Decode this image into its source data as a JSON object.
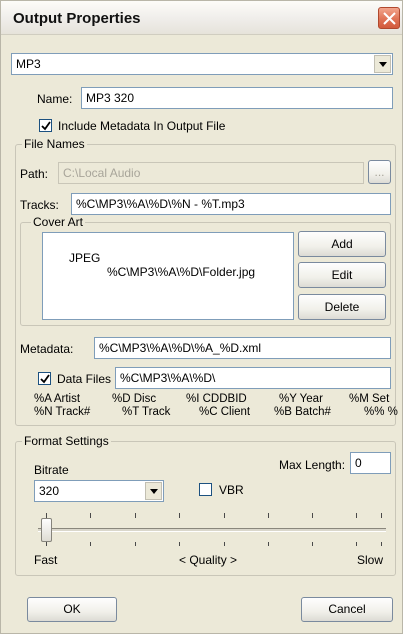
{
  "window": {
    "title": "Output Properties"
  },
  "format": {
    "selected": "MP3"
  },
  "name": {
    "label": "Name:",
    "value": "MP3 320"
  },
  "include_metadata": {
    "label": "Include Metadata In Output File",
    "checked": true
  },
  "file_names": {
    "group_label": "File Names",
    "path_label": "Path:",
    "path_value": "C:\\Local Audio",
    "browse_label": "...",
    "tracks_label": "Tracks:",
    "tracks_value": "%C\\MP3\\%A\\%D\\%N - %T.mp3"
  },
  "cover_art": {
    "group_label": "Cover Art",
    "items": [
      {
        "type": "JPEG",
        "path": "%C\\MP3\\%A\\%D\\Folder.jpg"
      }
    ],
    "add_label": "Add",
    "edit_label": "Edit",
    "delete_label": "Delete"
  },
  "metadata": {
    "label": "Metadata:",
    "value": "%C\\MP3\\%A\\%D\\%A_%D.xml"
  },
  "data_files": {
    "label": "Data Files",
    "checked": true,
    "value": "%C\\MP3\\%A\\%D\\"
  },
  "legend": {
    "row1": [
      "%A Artist",
      "%D Disc",
      "%I CDDBID",
      "%Y Year",
      "%M Set"
    ],
    "row2": [
      "%N Track#",
      "%T Track",
      "%C Client",
      "%B Batch#",
      "%% %"
    ]
  },
  "format_settings": {
    "group_label": "Format Settings",
    "bitrate_label": "Bitrate",
    "bitrate_value": "320",
    "vbr_label": "VBR",
    "vbr_checked": false,
    "max_length_label": "Max Length:",
    "max_length_value": "0",
    "quality_left": "Fast",
    "quality_center": "< Quality >",
    "quality_right": "Slow",
    "quality_level": 0
  },
  "buttons": {
    "ok_label": "OK",
    "cancel_label": "Cancel"
  }
}
